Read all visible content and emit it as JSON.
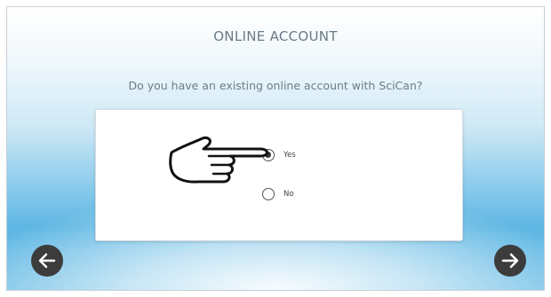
{
  "header": {
    "title": "ONLINE ACCOUNT"
  },
  "main": {
    "question": "Do you have an existing online account with SciCan?",
    "options": [
      {
        "label": "Yes",
        "selected": true
      },
      {
        "label": "No",
        "selected": false
      }
    ]
  },
  "nav": {
    "back_icon": "arrow-left-icon",
    "next_icon": "arrow-right-icon"
  },
  "overlay": {
    "pointer_icon": "pointing-hand-icon"
  },
  "colors": {
    "accent_blue": "#5db6e3",
    "nav_button": "#3c3c3c"
  }
}
